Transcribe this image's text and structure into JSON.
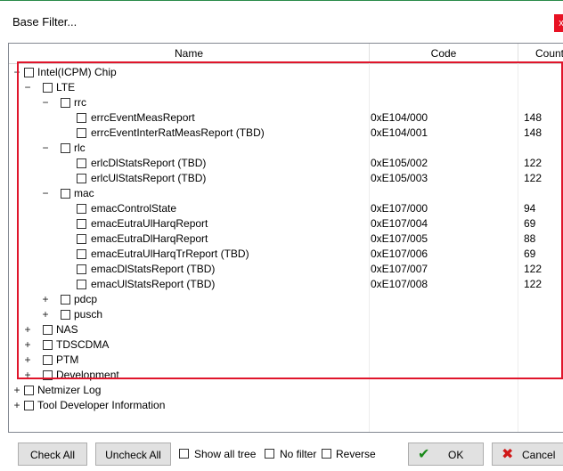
{
  "window": {
    "title": "Base Filter...",
    "close_glyph": "x"
  },
  "columns": {
    "name": "Name",
    "code": "Code",
    "count": "Count"
  },
  "rows": [
    {
      "toggle": "−",
      "label": "Intel(ICPM) Chip",
      "code": "",
      "count": "",
      "level": 0
    },
    {
      "toggle": "−",
      "label": "LTE",
      "code": "",
      "count": "",
      "level": 1
    },
    {
      "toggle": "−",
      "label": "rrc",
      "code": "",
      "count": "",
      "level": 2
    },
    {
      "toggle": "",
      "label": "errcEventMeasReport",
      "code": "0xE104/000",
      "count": "148",
      "level": 3
    },
    {
      "toggle": "",
      "label": "errcEventInterRatMeasReport (TBD)",
      "code": "0xE104/001",
      "count": "148",
      "level": 3
    },
    {
      "toggle": "−",
      "label": "rlc",
      "code": "",
      "count": "",
      "level": 2
    },
    {
      "toggle": "",
      "label": "erlcDlStatsReport (TBD)",
      "code": "0xE105/002",
      "count": "122",
      "level": 3
    },
    {
      "toggle": "",
      "label": "erlcUlStatsReport (TBD)",
      "code": "0xE105/003",
      "count": "122",
      "level": 3
    },
    {
      "toggle": "−",
      "label": "mac",
      "code": "",
      "count": "",
      "level": 2
    },
    {
      "toggle": "",
      "label": "emacControlState",
      "code": "0xE107/000",
      "count": "94",
      "level": 3
    },
    {
      "toggle": "",
      "label": "emacEutraUlHarqReport",
      "code": "0xE107/004",
      "count": "69",
      "level": 3
    },
    {
      "toggle": "",
      "label": "emacEutraDlHarqReport",
      "code": "0xE107/005",
      "count": "88",
      "level": 3
    },
    {
      "toggle": "",
      "label": "emacEutraUlHarqTrReport (TBD)",
      "code": "0xE107/006",
      "count": "69",
      "level": 3
    },
    {
      "toggle": "",
      "label": "emacDlStatsReport (TBD)",
      "code": "0xE107/007",
      "count": "122",
      "level": 3
    },
    {
      "toggle": "",
      "label": "emacUlStatsReport (TBD)",
      "code": "0xE107/008",
      "count": "122",
      "level": 3
    },
    {
      "toggle": "+",
      "label": "pdcp",
      "code": "",
      "count": "",
      "level": 2
    },
    {
      "toggle": "+",
      "label": "pusch",
      "code": "",
      "count": "",
      "level": 2
    },
    {
      "toggle": "+",
      "label": "NAS",
      "code": "",
      "count": "",
      "level": 1
    },
    {
      "toggle": "+",
      "label": "TDSCDMA",
      "code": "",
      "count": "",
      "level": 1
    },
    {
      "toggle": "+",
      "label": "PTM",
      "code": "",
      "count": "",
      "level": 1
    },
    {
      "toggle": "+",
      "label": "Development",
      "code": "",
      "count": "",
      "level": 1
    },
    {
      "toggle": "+",
      "label": "Netmizer Log",
      "code": "",
      "count": "",
      "level": 0
    },
    {
      "toggle": "+",
      "label": "Tool Developer Information",
      "code": "",
      "count": "",
      "level": 0
    }
  ],
  "toolbar": {
    "check_all": "Check All",
    "uncheck_all": "Uncheck All",
    "show_all_tree": "Show all tree",
    "no_filter": "No filter",
    "reverse": "Reverse",
    "ok": "OK",
    "cancel": "Cancel"
  },
  "colors": {
    "highlight": "#e0152b",
    "ok_icon": "#1a8a1a",
    "cancel_icon": "#d01818"
  }
}
